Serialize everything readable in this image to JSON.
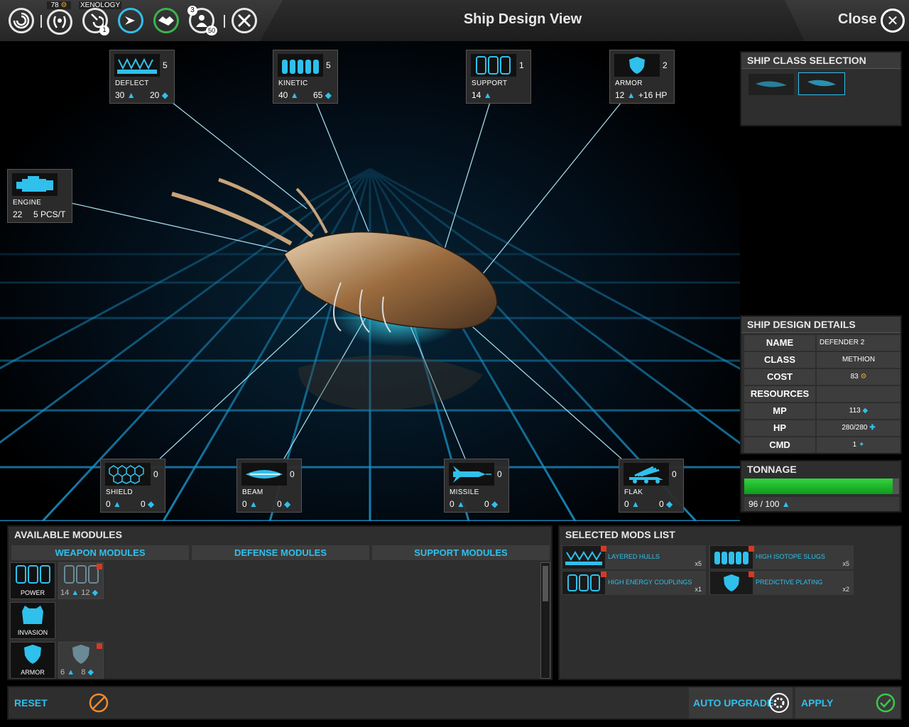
{
  "topbar": {
    "resource_count": "78",
    "research_label": "XENOLOGY",
    "research_badge": "1",
    "population_badge_top": "3",
    "population_badge_bottom": "50",
    "title": "Ship Design View",
    "close_label": "Close"
  },
  "slots": {
    "deflect": {
      "count": "5",
      "name": "DEFLECT",
      "v1": "30",
      "v2": "20"
    },
    "kinetic": {
      "count": "5",
      "name": "KINETIC",
      "v1": "40",
      "v2": "65"
    },
    "support": {
      "count": "1",
      "name": "SUPPORT",
      "v1": "14"
    },
    "armor": {
      "count": "2",
      "name": "ARMOR",
      "v1": "12",
      "v2": "+16 HP"
    },
    "engine": {
      "name": "ENGINE",
      "v1": "22",
      "v2": "5 PCS/T"
    },
    "shield": {
      "count": "0",
      "name": "SHIELD",
      "v1": "0",
      "v2": "0"
    },
    "beam": {
      "count": "0",
      "name": "BEAM",
      "v1": "0",
      "v2": "0"
    },
    "missile": {
      "count": "0",
      "name": "MISSILE",
      "v1": "0",
      "v2": "0"
    },
    "flak": {
      "count": "0",
      "name": "FLAK",
      "v1": "0",
      "v2": "0"
    }
  },
  "class_selection": {
    "title": "SHIP CLASS SELECTION"
  },
  "details": {
    "title": "SHIP DESIGN DETAILS",
    "rows": [
      {
        "k": "NAME",
        "v": "DEFENDER 2"
      },
      {
        "k": "CLASS",
        "v": "METHION"
      },
      {
        "k": "COST",
        "v": "83"
      },
      {
        "k": "RESOURCES",
        "v": ""
      },
      {
        "k": "MP",
        "v": "113"
      },
      {
        "k": "HP",
        "v": "280/280"
      },
      {
        "k": "CMD",
        "v": "1"
      }
    ]
  },
  "tonnage": {
    "title": "TONNAGE",
    "value": "96 / 100",
    "fraction": 0.96
  },
  "available": {
    "title": "AVAILABLE MODULES",
    "tabs": [
      "WEAPON MODULES",
      "DEFENSE MODULES",
      "SUPPORT MODULES"
    ],
    "modules": [
      {
        "label": "POWER"
      },
      {
        "v1": "14",
        "v2": "12"
      },
      {
        "label": "INVASION"
      },
      {
        "label": "ARMOR"
      },
      {
        "v1": "6",
        "v2": "8"
      }
    ]
  },
  "selected": {
    "title": "SELECTED MODS LIST",
    "mods": [
      {
        "name": "LAYERED HULLS",
        "qty": "x5"
      },
      {
        "name": "HIGH ISOTOPE SLUGS",
        "qty": "x5"
      },
      {
        "name": "HIGH ENERGY COUPLINGS",
        "qty": "x1"
      },
      {
        "name": "PREDICTIVE PLATING",
        "qty": "x2"
      }
    ]
  },
  "actions": {
    "reset": "RESET",
    "auto_upgrade": "AUTO UPGRADE",
    "apply": "APPLY"
  },
  "colors": {
    "accent": "#2fc0ec",
    "tonnage_fill": "#1fbf2f",
    "badge_red": "#d43a25"
  }
}
